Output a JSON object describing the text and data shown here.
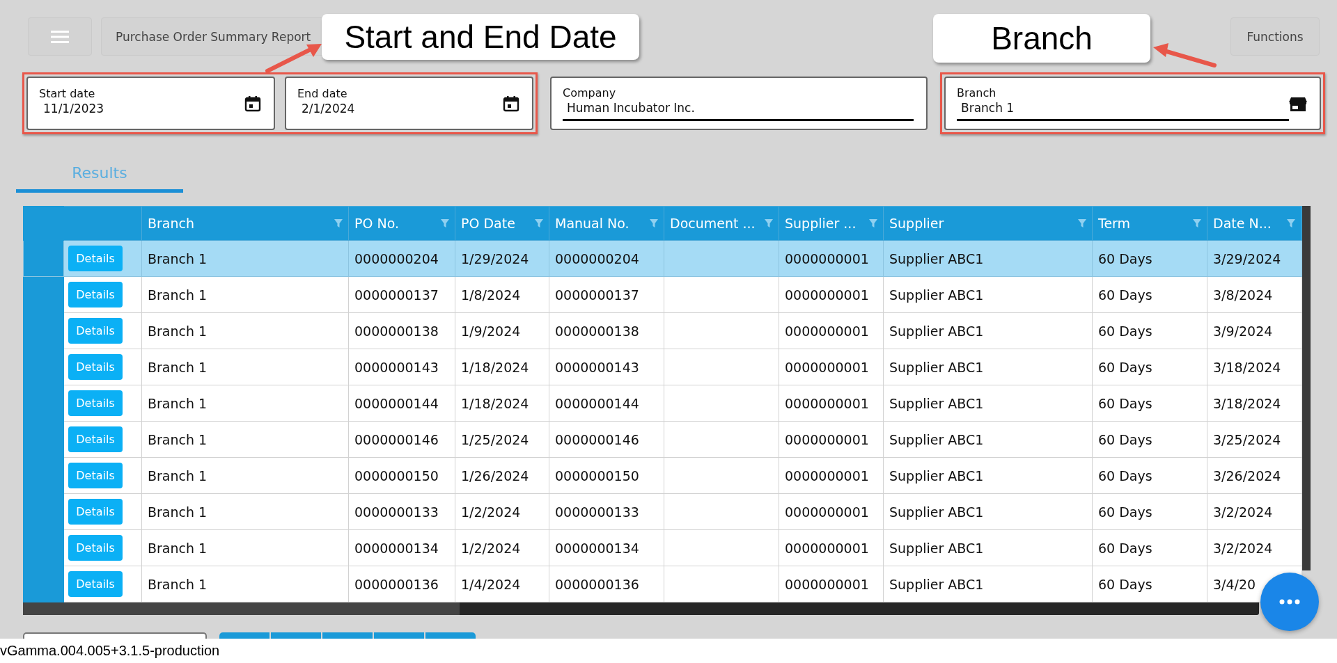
{
  "header": {
    "title": "Purchase Order Summary Report",
    "functions_button": "Functions"
  },
  "annotations": [
    {
      "kind": "dates",
      "text": "Start and End Date"
    },
    {
      "kind": "branch",
      "text": "Branch"
    }
  ],
  "filters": [
    {
      "kind": "date",
      "label": "Start date",
      "value": "11/1/2023",
      "highlighted": true
    },
    {
      "kind": "date",
      "label": "End date",
      "value": "2/1/2024",
      "highlighted": true
    },
    {
      "kind": "text",
      "label": "Company",
      "value": "Human Incubator Inc.",
      "highlighted": false
    },
    {
      "kind": "store",
      "label": "Branch",
      "value": "Branch 1",
      "highlighted": true
    }
  ],
  "tabs": [
    {
      "label": "Results",
      "selected": true
    }
  ],
  "table": {
    "columns": [
      "Branch",
      "PO No.",
      "PO Date",
      "Manual No.",
      "Document ...",
      "Supplier ...",
      "Supplier",
      "Term",
      "Date N..."
    ],
    "rows": [
      {
        "selected": true,
        "action": "Details",
        "cells": [
          "Branch 1",
          "0000000204",
          "1/29/2024",
          "0000000204",
          "",
          "0000000001",
          "Supplier ABC1",
          "60 Days",
          "3/29/2024"
        ]
      },
      {
        "selected": false,
        "action": "Details",
        "cells": [
          "Branch 1",
          "0000000137",
          "1/8/2024",
          "0000000137",
          "",
          "0000000001",
          "Supplier ABC1",
          "60 Days",
          "3/8/2024"
        ]
      },
      {
        "selected": false,
        "action": "Details",
        "cells": [
          "Branch 1",
          "0000000138",
          "1/9/2024",
          "0000000138",
          "",
          "0000000001",
          "Supplier ABC1",
          "60 Days",
          "3/9/2024"
        ]
      },
      {
        "selected": false,
        "action": "Details",
        "cells": [
          "Branch 1",
          "0000000143",
          "1/18/2024",
          "0000000143",
          "",
          "0000000001",
          "Supplier ABC1",
          "60 Days",
          "3/18/2024"
        ]
      },
      {
        "selected": false,
        "action": "Details",
        "cells": [
          "Branch 1",
          "0000000144",
          "1/18/2024",
          "0000000144",
          "",
          "0000000001",
          "Supplier ABC1",
          "60 Days",
          "3/18/2024"
        ]
      },
      {
        "selected": false,
        "action": "Details",
        "cells": [
          "Branch 1",
          "0000000146",
          "1/25/2024",
          "0000000146",
          "",
          "0000000001",
          "Supplier ABC1",
          "60 Days",
          "3/25/2024"
        ]
      },
      {
        "selected": false,
        "action": "Details",
        "cells": [
          "Branch 1",
          "0000000150",
          "1/26/2024",
          "0000000150",
          "",
          "0000000001",
          "Supplier ABC1",
          "60 Days",
          "3/26/2024"
        ]
      },
      {
        "selected": false,
        "action": "Details",
        "cells": [
          "Branch 1",
          "0000000133",
          "1/2/2024",
          "0000000133",
          "",
          "0000000001",
          "Supplier ABC1",
          "60 Days",
          "3/2/2024"
        ]
      },
      {
        "selected": false,
        "action": "Details",
        "cells": [
          "Branch 1",
          "0000000134",
          "1/2/2024",
          "0000000134",
          "",
          "0000000001",
          "Supplier ABC1",
          "60 Days",
          "3/2/2024"
        ]
      },
      {
        "selected": false,
        "action": "Details",
        "cells": [
          "Branch 1",
          "0000000136",
          "1/4/2024",
          "0000000136",
          "",
          "0000000001",
          "Supplier ABC1",
          "60 Days",
          "3/4/20"
        ]
      }
    ]
  },
  "version": "vGamma.004.005+3.1.5-production"
}
